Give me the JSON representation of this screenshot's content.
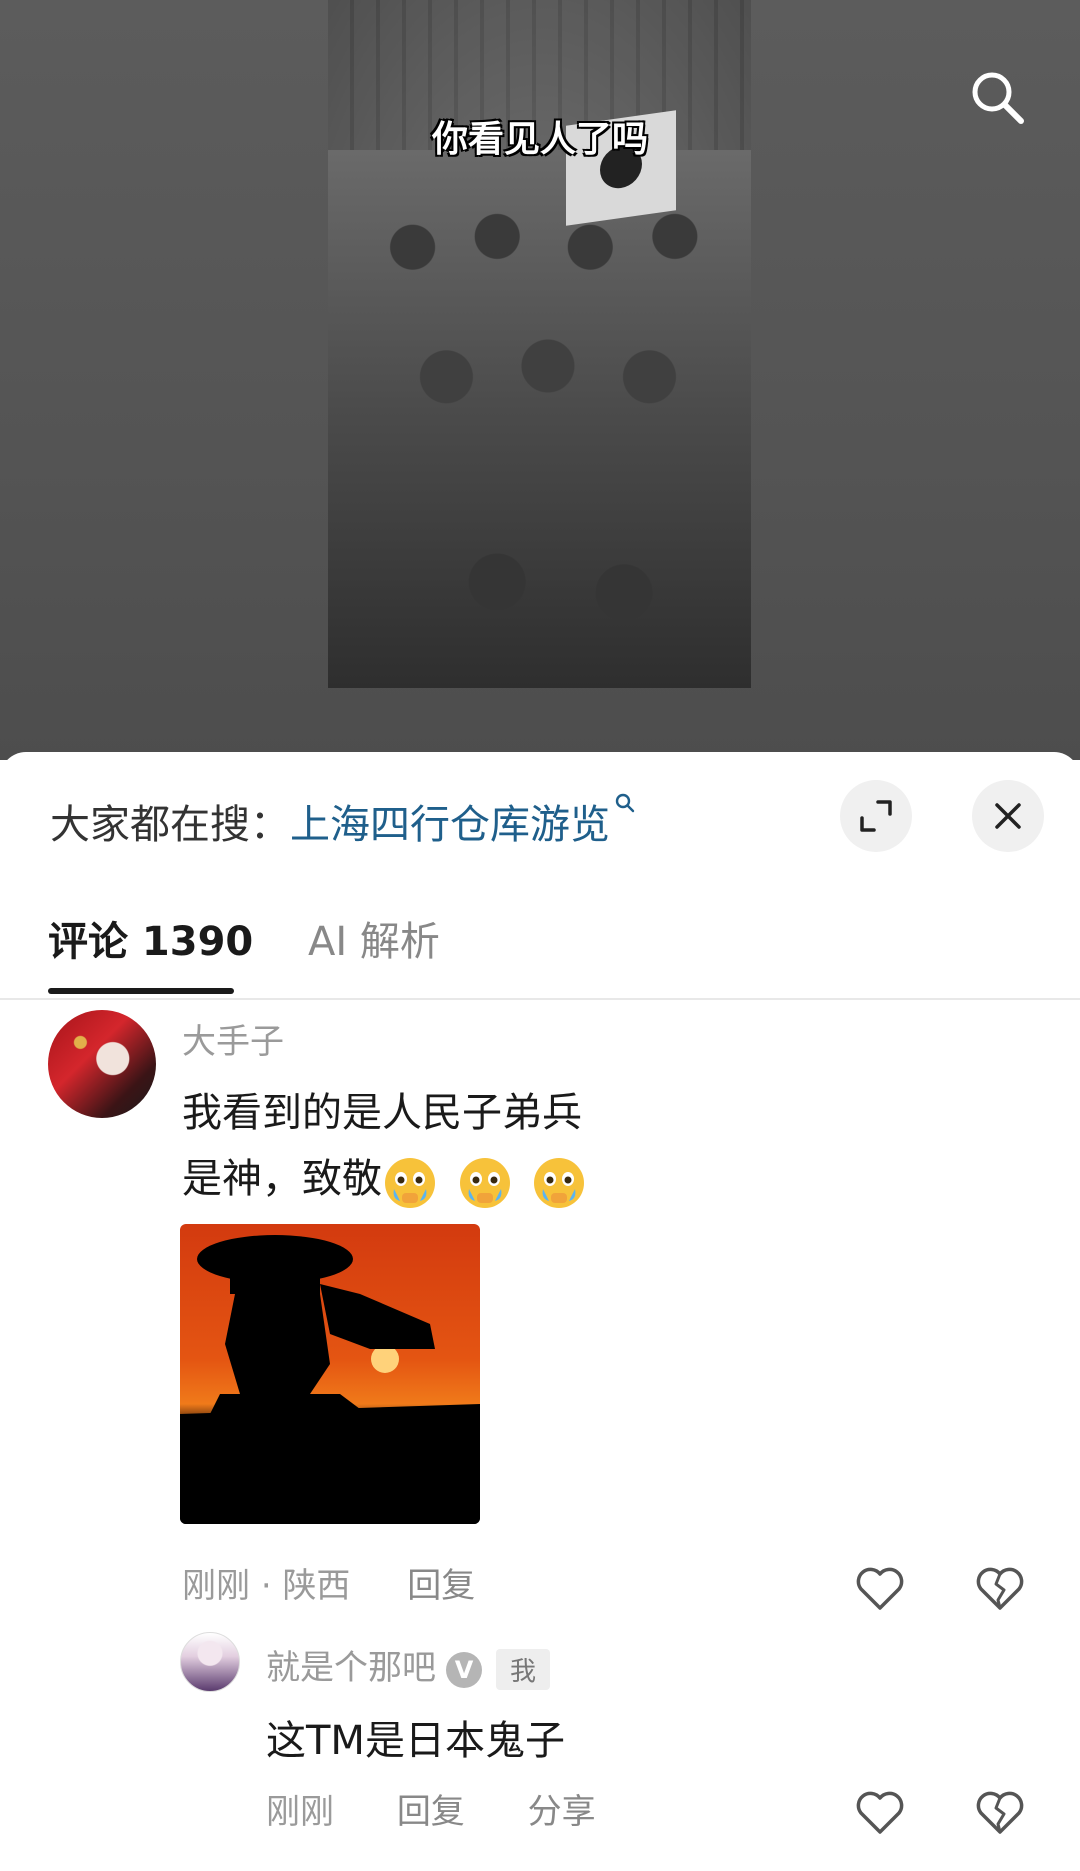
{
  "video": {
    "caption": "你看见人了吗",
    "search_icon": "search-icon"
  },
  "sheet": {
    "hot_search_prefix": "大家都在搜：",
    "hot_search_keyword": "上海四行仓库游览",
    "expand_icon": "expand-icon",
    "close_icon": "close-icon"
  },
  "tabs": [
    {
      "label": "评论 1390",
      "active": true
    },
    {
      "label": "AI 解析",
      "active": false
    }
  ],
  "comment": {
    "author": "大手子",
    "text_line1": "我看到的是人民子弟兵",
    "text_line2": "是神，致敬",
    "emojis": [
      "crying-emoji",
      "crying-emoji",
      "crying-emoji"
    ],
    "image": "saluting-soldier-silhouette-sunset",
    "time": "刚刚",
    "dot": "·",
    "location": "陕西",
    "reply_label": "回复"
  },
  "reply": {
    "author": "就是个那吧",
    "verified_badge": "V",
    "me_tag": "我",
    "text": "这TM是日本鬼子",
    "time": "刚刚",
    "reply_label": "回复",
    "share_label": "分享"
  },
  "colors": {
    "keyword": "#1f5f8b",
    "muted": "#9a9a9a",
    "text": "#1a1a1a"
  }
}
